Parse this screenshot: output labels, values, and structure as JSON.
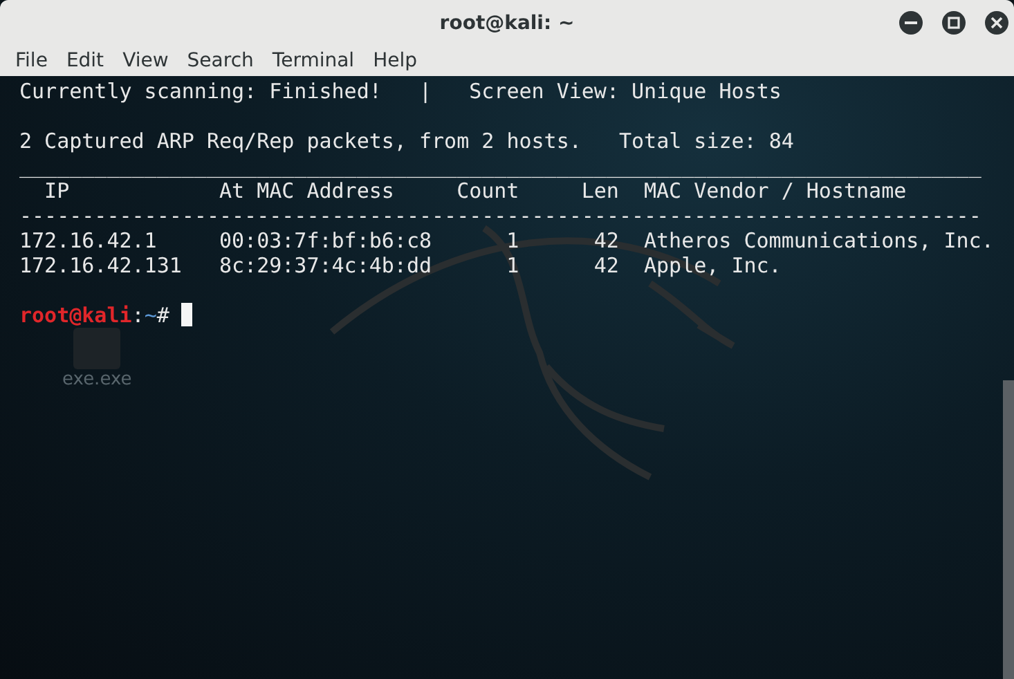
{
  "window": {
    "title": "root@kali: ~"
  },
  "menu": [
    {
      "label": "File"
    },
    {
      "label": "Edit"
    },
    {
      "label": "View"
    },
    {
      "label": "Search"
    },
    {
      "label": "Terminal"
    },
    {
      "label": "Help"
    }
  ],
  "terminal": {
    "status_line": "Currently scanning: Finished!   |   Screen View: Unique Hosts",
    "summary_line": "2 Captured ARP Req/Rep packets, from 2 hosts.   Total size: 84",
    "top_rule": "_____________________________________________________________________________",
    "columns": [
      "IP",
      "At MAC Address",
      "Count",
      "Len",
      "MAC Vendor / Hostname"
    ],
    "header_rule": "-----------------------------------------------------------------------------",
    "rows": [
      [
        "172.16.42.1",
        "00:03:7f:bf:b6:c8",
        "1",
        "42",
        "Atheros Communications, Inc."
      ],
      [
        "172.16.42.131",
        "8c:29:37:4c:4b:dd",
        "1",
        "42",
        "Apple, Inc."
      ]
    ],
    "prompt": {
      "user_host": "root@kali",
      "separator": ":",
      "path": "~",
      "symbol": "#"
    }
  },
  "desktop": {
    "icons": [
      {
        "label": "exe.exe"
      }
    ]
  }
}
